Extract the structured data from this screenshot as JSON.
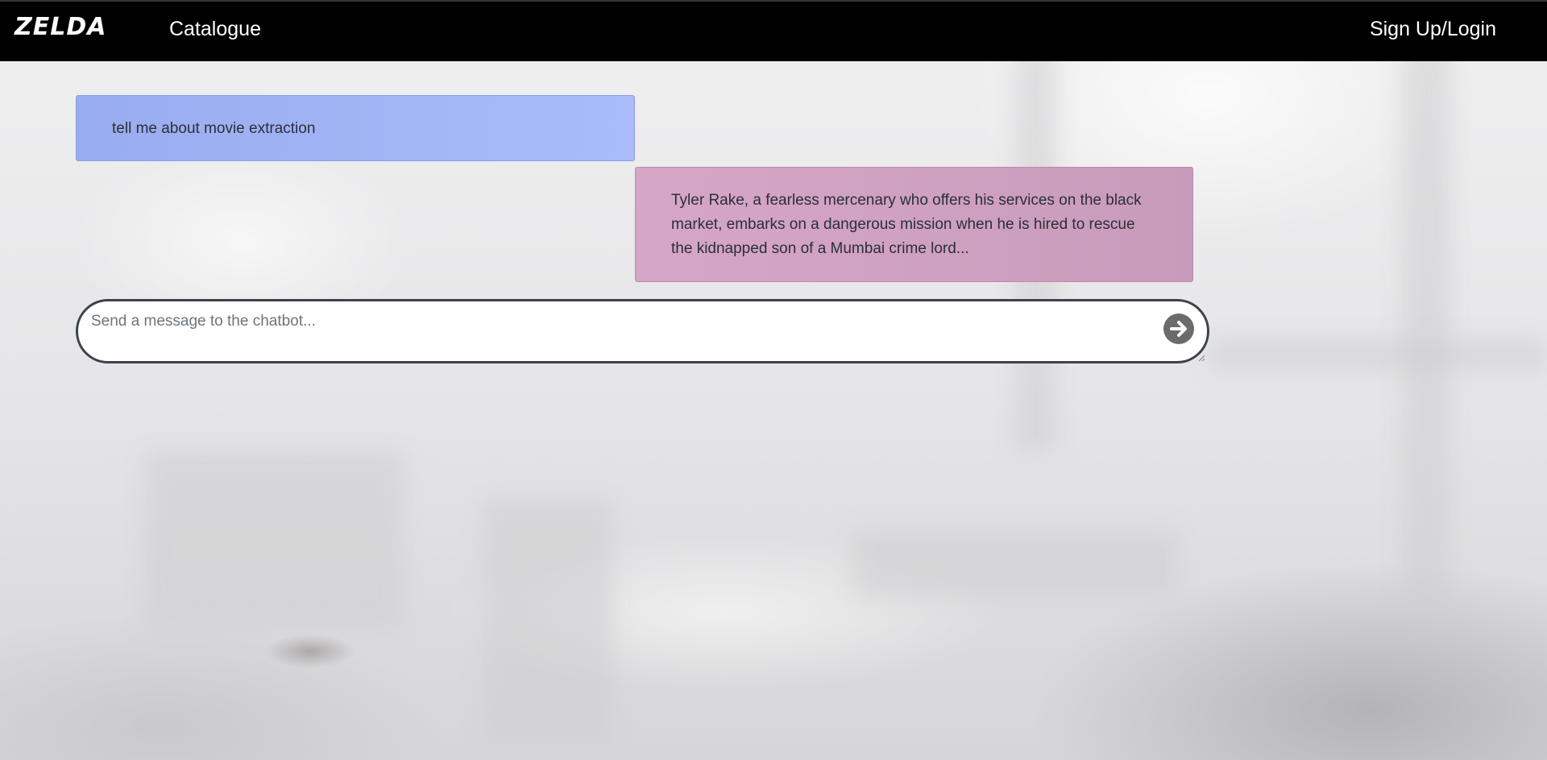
{
  "navbar": {
    "brand": "ZELDA",
    "catalogue_label": "Catalogue",
    "login_label": "Sign Up/Login"
  },
  "chat": {
    "messages": [
      {
        "role": "user",
        "text": "tell me about movie extraction"
      },
      {
        "role": "bot",
        "text": "Tyler Rake, a fearless mercenary who offers his services on the black market, embarks on a dangerous mission when he is hired to rescue the kidnapped son of a Mumbai crime lord..."
      }
    ],
    "input": {
      "value": "",
      "placeholder": "Send a message to the chatbot..."
    },
    "send_icon": "arrow-right-circle-icon"
  },
  "colors": {
    "navbar_bg": "#000000",
    "user_bubble": "#a6b9f8",
    "bot_bubble": "#cfa2c2",
    "send_button": "#6b6b6b"
  }
}
